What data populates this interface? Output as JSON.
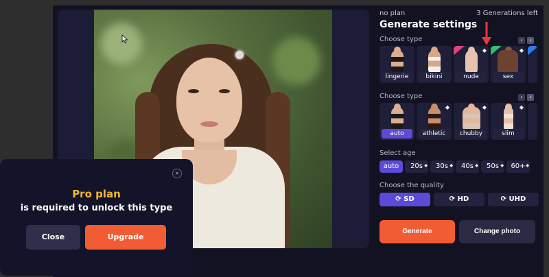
{
  "panel": {
    "plan_label": "no plan",
    "generations_left": "3 Generations left",
    "title": "Generate settings"
  },
  "type_section_1": {
    "label": "Choose type",
    "tiles": [
      {
        "label": "lingerie",
        "active": false
      },
      {
        "label": "bikini",
        "active": false
      },
      {
        "label": "nude",
        "active": false,
        "locked": true
      },
      {
        "label": "sex",
        "active": false
      }
    ]
  },
  "type_section_2": {
    "label": "Choose type",
    "tiles": [
      {
        "label": "auto",
        "active": true
      },
      {
        "label": "athletic",
        "active": false
      },
      {
        "label": "chubby",
        "active": false
      },
      {
        "label": "slim",
        "active": false
      }
    ]
  },
  "age": {
    "label": "Select age",
    "options": [
      "auto",
      "20s",
      "30s",
      "40s",
      "50s",
      "60+"
    ],
    "selected": "auto"
  },
  "quality": {
    "label": "Choose the quality",
    "options": [
      "SD",
      "HD",
      "UHD"
    ],
    "selected": "SD"
  },
  "actions": {
    "generate": "Generate",
    "change_photo": "Change photo"
  },
  "modal": {
    "title": "Pro plan",
    "subtitle": "is required to unlock this type",
    "close": "Close",
    "upgrade": "Upgrade",
    "close_icon": "×"
  },
  "icons": {
    "gem": "gem-icon",
    "refresh": "refresh-icon",
    "arrow_left": "‹",
    "arrow_right": "›"
  },
  "colors": {
    "accent_purple": "#5b4bd8",
    "accent_orange": "#f25c34",
    "pro_gold": "#f4b72c",
    "red_arrow": "#e23b3b"
  }
}
